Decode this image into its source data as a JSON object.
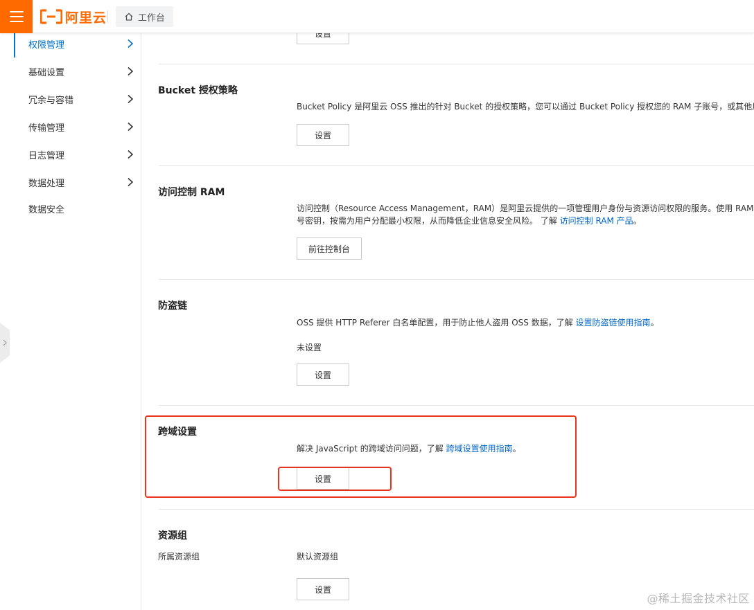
{
  "brand": {
    "logo_text": "阿里云",
    "accent": "#ff6a00"
  },
  "topbar": {
    "workbench_label": "工作台"
  },
  "sidebar": {
    "items": [
      {
        "label": "权限管理",
        "active": true,
        "has_arrow": true
      },
      {
        "label": "基础设置",
        "active": false,
        "has_arrow": true
      },
      {
        "label": "冗余与容错",
        "active": false,
        "has_arrow": true
      },
      {
        "label": "传输管理",
        "active": false,
        "has_arrow": true
      },
      {
        "label": "日志管理",
        "active": false,
        "has_arrow": true
      },
      {
        "label": "数据处理",
        "active": false,
        "has_arrow": true
      },
      {
        "label": "数据安全",
        "active": false,
        "has_arrow": false
      }
    ],
    "active_color": "#0070cc"
  },
  "sections": {
    "top": {
      "button": "设置"
    },
    "bucket_policy": {
      "title": "Bucket 授权策略",
      "desc": "Bucket Policy 是阿里云 OSS 推出的针对 Bucket 的授权策略，您可以通过 Bucket Policy 授权您的 RAM 子账号，或其他用户",
      "button": "设置"
    },
    "ram": {
      "title": "访问控制 RAM",
      "desc_line1": "访问控制（Resource Access Management，RAM）是阿里云提供的一项管理用户身份与资源访问权限的服务。使用 RAM，",
      "desc_line2_pre": "号密钥，按需为用户分配最小权限，从而降低企业信息安全风险。 了解 ",
      "desc_line2_link": "访问控制 RAM 产品",
      "desc_line2_post": "。",
      "button": "前往控制台"
    },
    "hotlink": {
      "title": "防盗链",
      "desc_pre": "OSS 提供 HTTP Referer 白名单配置，用于防止他人盗用 OSS 数据，了解 ",
      "desc_link": "设置防盗链使用指南",
      "desc_post": "。",
      "status": "未设置",
      "button": "设置"
    },
    "cors": {
      "title": "跨域设置",
      "desc_pre": "解决 JavaScript 的跨域访问问题，了解 ",
      "desc_link": "跨域设置使用指南",
      "desc_post": "。",
      "button": "设置"
    },
    "resource_group": {
      "title": "资源组",
      "field_label": "所属资源组",
      "field_value": "默认资源组",
      "button": "设置"
    }
  },
  "highlight_color": "#e8341c",
  "watermark": "@稀土掘金技术社区"
}
